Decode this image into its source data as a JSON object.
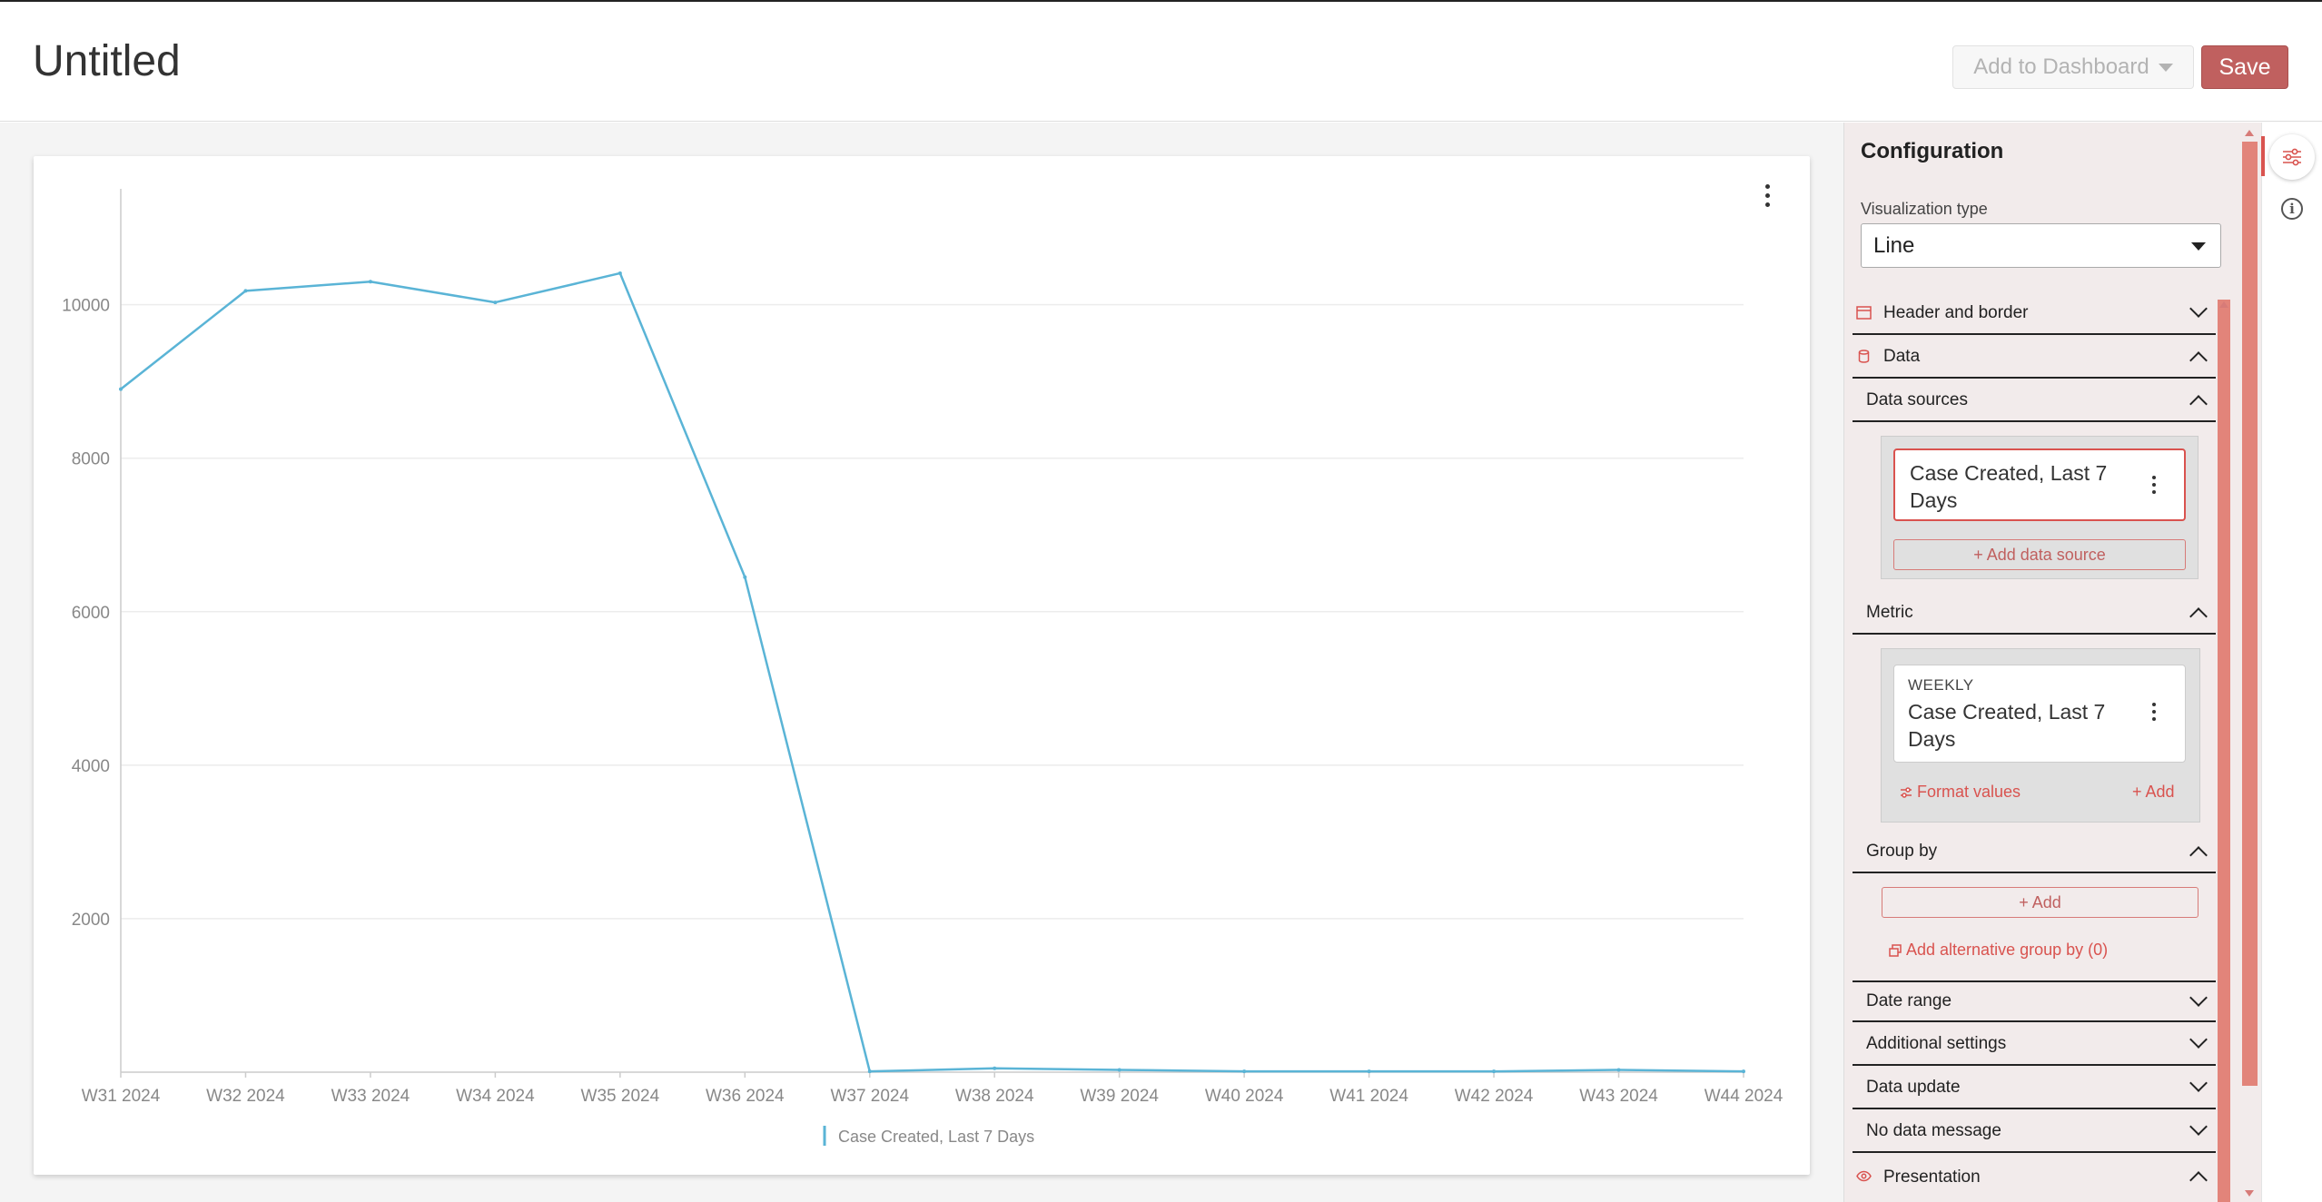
{
  "header": {
    "title": "Untitled",
    "add_to_dashboard": "Add to Dashboard",
    "save": "Save"
  },
  "chart_data": {
    "type": "line",
    "categories": [
      "W31 2024",
      "W32 2024",
      "W33 2024",
      "W34 2024",
      "W35 2024",
      "W36 2024",
      "W37 2024",
      "W38 2024",
      "W39 2024",
      "W40 2024",
      "W41 2024",
      "W42 2024",
      "W43 2024",
      "W44 2024"
    ],
    "series": [
      {
        "name": "Case Created, Last 7 Days",
        "values": [
          8900,
          10180,
          10300,
          10030,
          10410,
          6450,
          10,
          50,
          30,
          10,
          10,
          10,
          30,
          10
        ]
      }
    ],
    "yticks": [
      2000,
      4000,
      6000,
      8000,
      10000
    ],
    "ylim": [
      0,
      10800
    ],
    "grid": true,
    "legend": "bottom-center",
    "color": "#5ab4d6"
  },
  "panel": {
    "heading": "Configuration",
    "viz_label": "Visualization type",
    "viz_value": "Line",
    "sections": {
      "header_border": "Header and border",
      "data": "Data",
      "data_sources": "Data sources",
      "metric": "Metric",
      "group_by": "Group by",
      "date_range": "Date range",
      "additional_settings": "Additional settings",
      "data_update": "Data update",
      "no_data_message": "No data message",
      "presentation": "Presentation"
    },
    "data_source_name": "Case Created, Last 7 Days",
    "add_data_source": "+ Add data source",
    "metric_period": "WEEKLY",
    "metric_name": "Case Created, Last 7 Days",
    "format_values": "Format values",
    "metric_add": "+ Add",
    "group_add": "+ Add",
    "alt_group_by": "Add alternative group by (0)"
  },
  "colors": {
    "accent": "#d9534f",
    "save": "#c0605f",
    "line": "#5ab4d6"
  }
}
